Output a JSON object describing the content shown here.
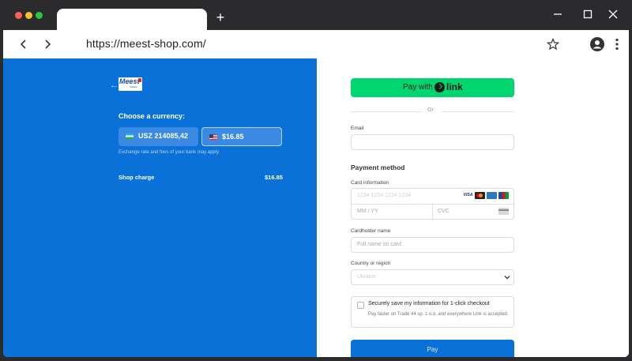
{
  "browser": {
    "url": "https://meest-shop.com/",
    "new_tab_label": "+"
  },
  "left": {
    "back_arrow": "←",
    "logo": {
      "text": "Meest",
      "subtext": "CHINA",
      "colors": {
        "brand": "#1c4fa0",
        "accent": "#e2262b"
      }
    },
    "choose_currency_label": "Choose a currency:",
    "currencies": [
      {
        "label": "USZ 214085,42",
        "flag": "uz-flag",
        "selected": false
      },
      {
        "label": "$16.85",
        "flag": "us-flag",
        "selected": true
      }
    ],
    "exchange_note": "Exchange rate and fees of your bank may apply",
    "shop_charge_label": "Shop charge",
    "shop_charge_value": "$16.85",
    "colors": {
      "background": "#0a71d8"
    }
  },
  "right": {
    "link_button": {
      "prefix": "Pay with",
      "word": "link",
      "color": "#00d66f"
    },
    "or_label": "Or",
    "email_label": "Email",
    "email_value": "",
    "payment_method_label": "Payment method",
    "card_info_label": "Card information",
    "card_number_placeholder": "1234 1234 1234 1234",
    "expiry_placeholder": "MM / YY",
    "cvc_placeholder": "CVC",
    "card_brands": [
      "VISA",
      "MC",
      "AMEX",
      "JCB"
    ],
    "cardholder_label": "Cardholder name",
    "cardholder_placeholder": "Full name on card",
    "country_label": "Country or region",
    "country_value": "Ukraine",
    "save_info_title": "Securely save my information for 1-click checkout",
    "save_info_desc": "Pay faster on Trade 44 sp. z o.o. and everywhere Link is accepted.",
    "save_info_checked": false,
    "pay_label": "Pay",
    "colors": {
      "pay_button": "#0a71d8"
    }
  }
}
